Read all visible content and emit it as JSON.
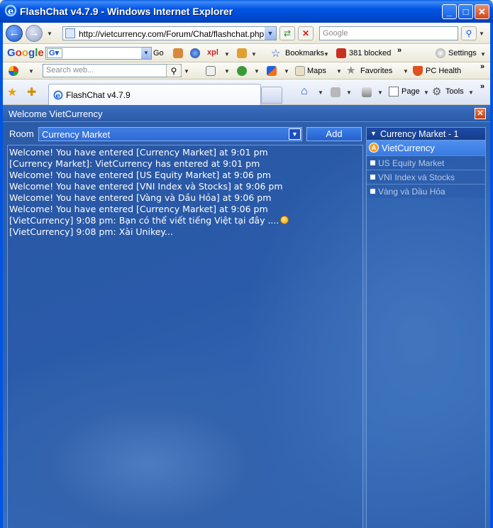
{
  "window": {
    "title": "FlashChat v4.7.9 - Windows Internet Explorer",
    "minimize": "_",
    "maximize": "□",
    "close": "✕"
  },
  "address_bar": {
    "url": "http://vietcurrency.com/Forum/Chat/flashchat.php",
    "search_placeholder": "Google"
  },
  "google_toolbar": {
    "go_label": "Go",
    "bookmarks_label": "Bookmarks",
    "blocked_label": "381 blocked",
    "settings_label": "Settings"
  },
  "search_toolbar": {
    "search_placeholder": "Search web...",
    "maps_label": "Maps",
    "favorites_label": "Favorites",
    "pchealth_label": "PC Health"
  },
  "tabs": {
    "active_label": "FlashChat v4.7.9",
    "page_label": "Page",
    "tools_label": "Tools"
  },
  "chat": {
    "header_title": "Welcome VietCurrency",
    "room_label": "Room",
    "room_selected": "Currency Market",
    "add_label": "Add",
    "messages": [
      "Welcome! You have entered [Currency Market] at 9:01 pm",
      "[Currency Market]: VietCurrency has entered at 9:01 pm",
      "Welcome! You have entered [US Equity Market] at 9:06 pm",
      "Welcome! You have entered [VNI Index và Stocks] at 9:06 pm",
      "Welcome! You have entered [Vàng và Dầu Hỏa] at 9:06 pm",
      "Welcome! You have entered [Currency Market] at 9:06 pm",
      "[VietCurrency] 9:08 pm: Bạn có thể viết tiếng Việt tại đây ....",
      "[VietCurrency] 9:08 pm: Xài Unikey..."
    ]
  },
  "user_panel": {
    "current_room": "Currency Market - 1",
    "current_user": "VietCurrency",
    "user_initial": "A",
    "other_rooms": [
      "US Equity Market",
      "VNI Index và Stocks",
      "Vàng và Dầu Hỏa"
    ]
  },
  "colors": {
    "title_bar": "#0054e3",
    "chat_bg": "#2e62b0",
    "selected_user": "#4d90f0"
  }
}
